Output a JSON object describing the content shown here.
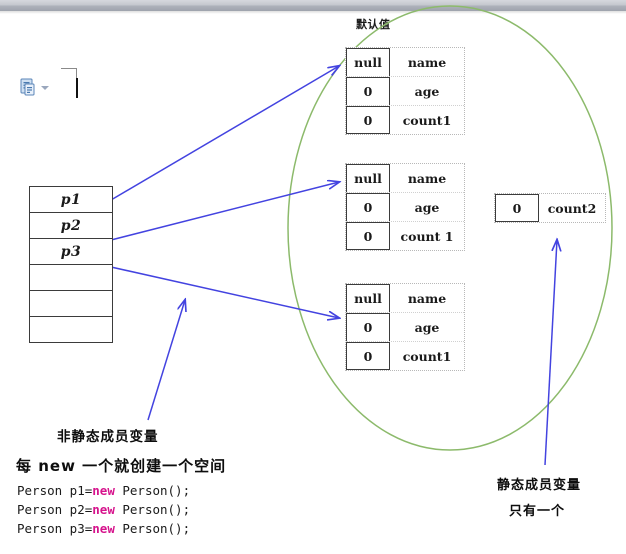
{
  "window": {
    "title": "Word document slide - static vs non-static member variables"
  },
  "toolbar": {
    "paste_icon": "paste-options-icon",
    "dropdown_icon": "chevron-down-icon",
    "margin_marker": "page-margin-marker",
    "text_caret": "text-cursor"
  },
  "diagram": {
    "default_value_label": "默认值",
    "variable_stack": {
      "name": "reference-variable-stack",
      "cells": [
        "p1",
        "p2",
        "p3",
        "",
        "",
        ""
      ]
    },
    "objects": [
      {
        "id": "person-object-1",
        "fields": [
          {
            "value": "null",
            "name": "name"
          },
          {
            "value": "0",
            "name": "age"
          },
          {
            "value": "0",
            "name": "count1"
          }
        ]
      },
      {
        "id": "person-object-2",
        "fields": [
          {
            "value": "null",
            "name": "name"
          },
          {
            "value": "0",
            "name": "age"
          },
          {
            "value": "0",
            "name": "count 1"
          }
        ]
      },
      {
        "id": "person-object-3",
        "fields": [
          {
            "value": "null",
            "name": "name"
          },
          {
            "value": "0",
            "name": "age"
          },
          {
            "value": "0",
            "name": "count1"
          }
        ]
      }
    ],
    "static_area": {
      "id": "static-variable-box",
      "value": "0",
      "name": "count2"
    },
    "ellipse": {
      "name": "heap-region-ellipse",
      "color": "#8cba6b"
    },
    "arrows": {
      "color": "#4343e0"
    }
  },
  "annotations": {
    "non_static": "非静态成员变量",
    "new_space": "每 new 一个就创建一个空间",
    "static": "静态成员变量",
    "only_one": "只有一个"
  },
  "code": {
    "lines": [
      {
        "pre": "Person p1=",
        "kw": "new",
        "post": " Person();"
      },
      {
        "pre": "Person p2=",
        "kw": "new",
        "post": " Person();"
      },
      {
        "pre": "Person p3=",
        "kw": "new",
        "post": " Person();"
      }
    ],
    "line1_pre": "Person p1=",
    "line1_kw": "new",
    "line1_post": " Person();",
    "line2_pre": "Person p2=",
    "line2_kw": "new",
    "line2_post": " Person();",
    "line3_pre": "Person p3=",
    "line3_kw": "new",
    "line3_post": " Person();"
  },
  "colors": {
    "arrow_blue": "#4343e0",
    "ellipse_green": "#8cba6b",
    "keyword_magenta": "#d6138c",
    "box_border": "#3b3b3b",
    "chrome_gray": "#aeb2bb"
  }
}
